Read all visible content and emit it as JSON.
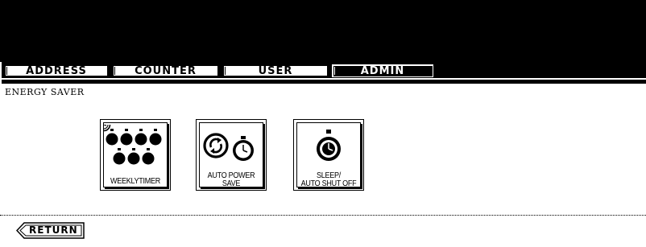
{
  "tabs": [
    {
      "label": "ADDRESS",
      "active": false
    },
    {
      "label": "COUNTER",
      "active": false
    },
    {
      "label": "USER",
      "active": false
    },
    {
      "label": "ADMIN",
      "active": true
    }
  ],
  "screen": {
    "title": "ENERGY SAVER"
  },
  "buttons": {
    "weekly_timer": {
      "label": "WEEKLYTIMER",
      "icon": "clocks-icon"
    },
    "auto_power_save": {
      "line1": "AUTO POWER",
      "line2": "SAVE",
      "icon": "power-save-icon"
    },
    "sleep_auto_shut_off": {
      "line1": "SLEEP/",
      "line2": "AUTO SHUT OFF",
      "icon": "stopwatch-icon"
    }
  },
  "footer": {
    "return_label": "RETURN"
  }
}
